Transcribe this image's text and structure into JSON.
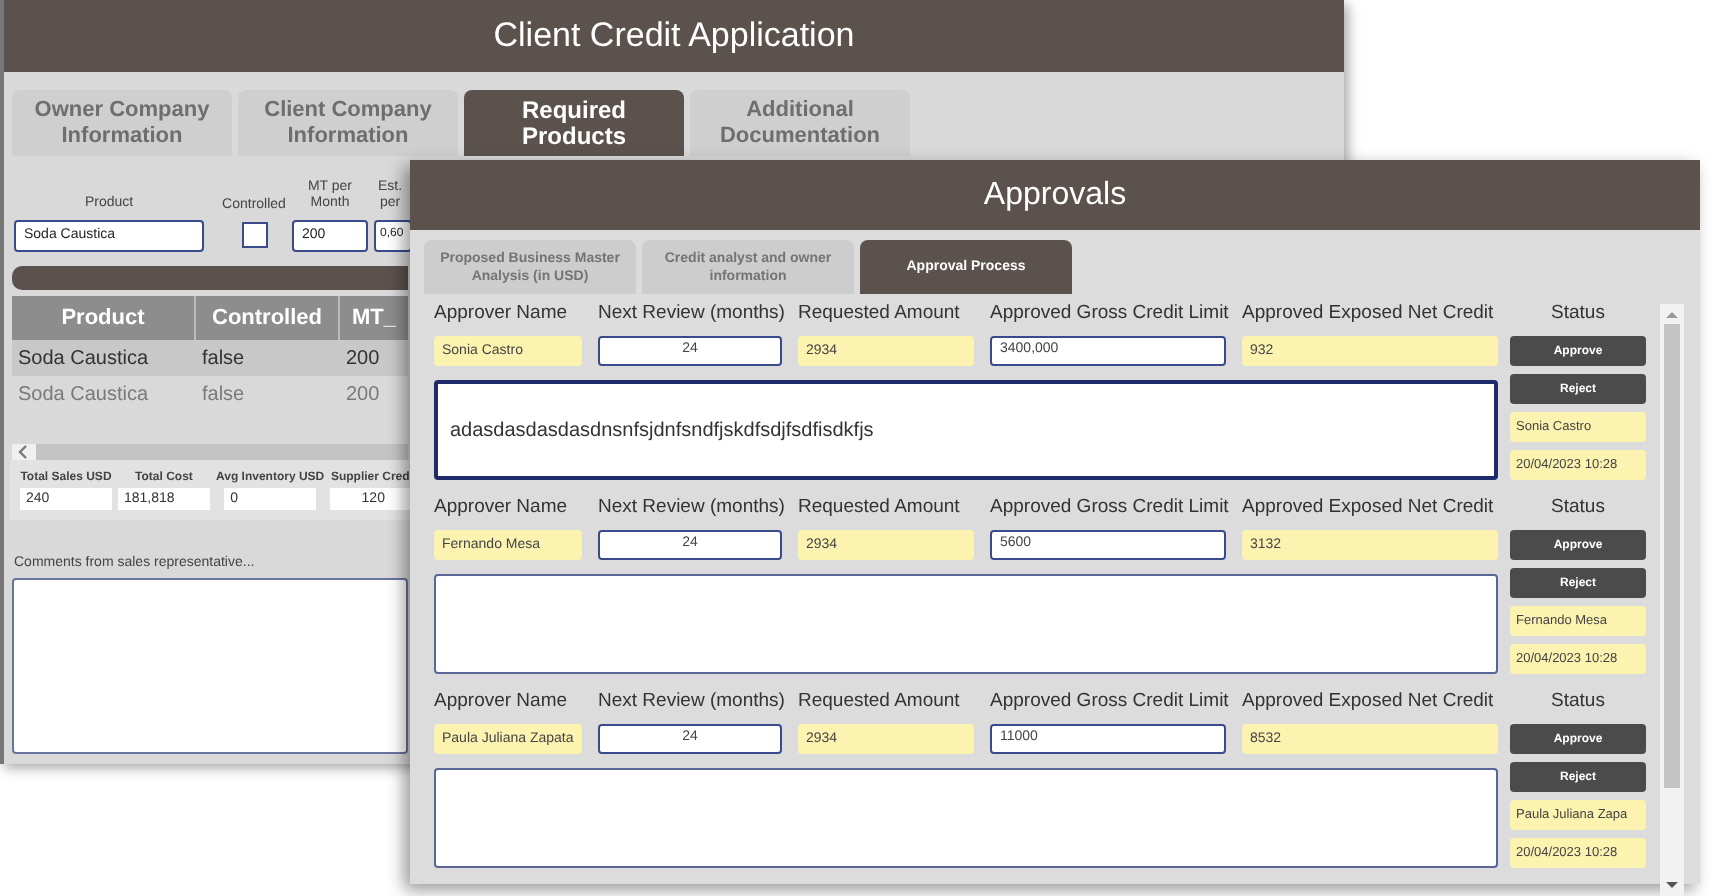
{
  "back_window": {
    "title": "Client Credit Application",
    "tabs": [
      {
        "label": "Owner Company Information",
        "selected": false
      },
      {
        "label": "Client Company Information",
        "selected": false
      },
      {
        "label": "Required Products",
        "selected": true
      },
      {
        "label": "Additional Documentation",
        "selected": false
      }
    ],
    "product_form": {
      "labels": [
        "Product",
        "Controlled",
        "MT per Month",
        "Est. per"
      ],
      "product": "Soda Caustica",
      "controlled": false,
      "mt_per_month": "200",
      "est": "0,60"
    },
    "table": {
      "columns": [
        "Product",
        "Controlled",
        "MT_"
      ],
      "rows": [
        {
          "cells": [
            "Soda Caustica",
            "false",
            "200"
          ],
          "selected": true
        },
        {
          "cells": [
            "Soda Caustica",
            "false",
            "200"
          ],
          "selected": false
        }
      ]
    },
    "totals": [
      {
        "label": "Total Sales USD",
        "value": "240"
      },
      {
        "label": "Total Cost",
        "value": "181,818"
      },
      {
        "label": "Avg Inventory USD",
        "value": "0"
      },
      {
        "label": "Supplier Cred",
        "value": "120"
      }
    ],
    "comments_label": "Comments from sales representative..."
  },
  "front_window": {
    "title": "Approvals",
    "tabs": [
      {
        "label": "Proposed Business Master Analysis (in USD)",
        "selected": false
      },
      {
        "label": "Credit analyst and owner information",
        "selected": false
      },
      {
        "label": "Approval Process",
        "selected": true
      }
    ],
    "approvals": [
      {
        "headers": [
          "Approver Name",
          "Next Review (months)",
          "Requested Amount",
          "Approved Gross Credit Limit",
          "Approved Exposed Net Credit",
          "Status"
        ],
        "approver_name": "Sonia Castro",
        "next_review": "24",
        "requested_amount": "2934",
        "approved_gross": "3400,000",
        "approved_exposed": "932",
        "comment": "adasdasdasdasdnsnfsjdnfsndfjskdfsdjfsdfisdkfjs",
        "approve": "Approve",
        "reject": "Reject",
        "status_name": "Sonia Castro",
        "status_date": "20/04/2023 10:28"
      },
      {
        "headers": [
          "Approver Name",
          "Next Review (months)",
          "Requested Amount",
          "Approved Gross Credit Limit",
          "Approved Exposed Net Credit",
          "Status"
        ],
        "approver_name": "Fernando Mesa",
        "next_review": "24",
        "requested_amount": "2934",
        "approved_gross": "5600",
        "approved_exposed": "3132",
        "approve": "Approve",
        "reject": "Reject",
        "status_name": "Fernando Mesa",
        "status_date": "20/04/2023 10:28"
      },
      {
        "headers": [
          "Approver Name",
          "Next Review (months)",
          "Requested Amount",
          "Approved Gross Credit Limit",
          "Approved Exposed Net Credit",
          "Status"
        ],
        "approver_name": "Paula Juliana Zapata",
        "next_review": "24",
        "requested_amount": "2934",
        "approved_gross": "11000",
        "approved_exposed": "8532",
        "approve": "Approve",
        "reject": "Reject",
        "status_name": "Paula Juliana Zapa",
        "status_date": "20/04/2023 10:28"
      }
    ]
  }
}
